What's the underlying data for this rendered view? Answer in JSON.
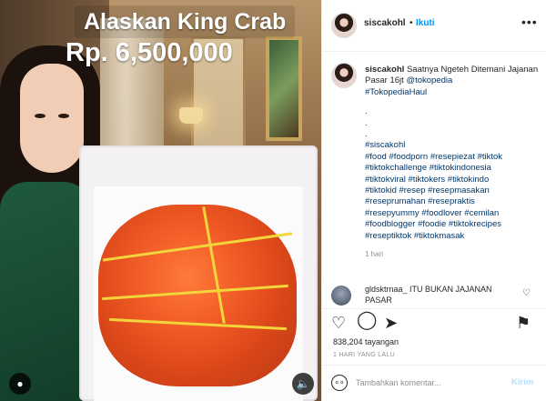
{
  "media": {
    "title_overlay": "Alaskan King Crab",
    "price_overlay": "Rp. 6,500,000",
    "user_tag_icon": "person-icon",
    "mute_icon": "speaker-icon"
  },
  "header": {
    "username": "siscakohl",
    "separator": "•",
    "follow_label": "Ikuti",
    "more_icon": "more-options-icon"
  },
  "caption": {
    "username": "siscakohl",
    "text_start": "Saatnya Ngeteh Ditemani Jajanan Pasar 16jt",
    "mention": "@tokopedia",
    "hashtag_first": "#TokopediaHaul",
    "dots": [
      ".",
      ".",
      "."
    ],
    "hashtag_lines": [
      "#siscakohl",
      "#food #foodporn #resepiezat #tiktok",
      "#tiktokchallenge #tiktokindonesia",
      "#tiktokviral #tiktokers #tiktokindo",
      "#tiktokid #resep #resepmasakan",
      "#reseprumahan #resepraktis",
      "#resepyummy #foodlover #cemilan",
      "#foodblogger #foodie #tiktokrecipes",
      "#reseptiktok #tiktokmasak"
    ],
    "time": "1 hari"
  },
  "comment": {
    "username": "gldsktrnaa_",
    "text": "ITU BUKAN JAJANAN PASAR"
  },
  "actions": {
    "views": "838,204 tayangan",
    "time_ago": "1 HARI YANG LALU"
  },
  "add_comment": {
    "placeholder": "Tambahkan komentar...",
    "post_label": "Kirim"
  },
  "colors": {
    "link": "#00376b",
    "follow": "#0095f6",
    "post_disabled": "#b2dffc"
  }
}
